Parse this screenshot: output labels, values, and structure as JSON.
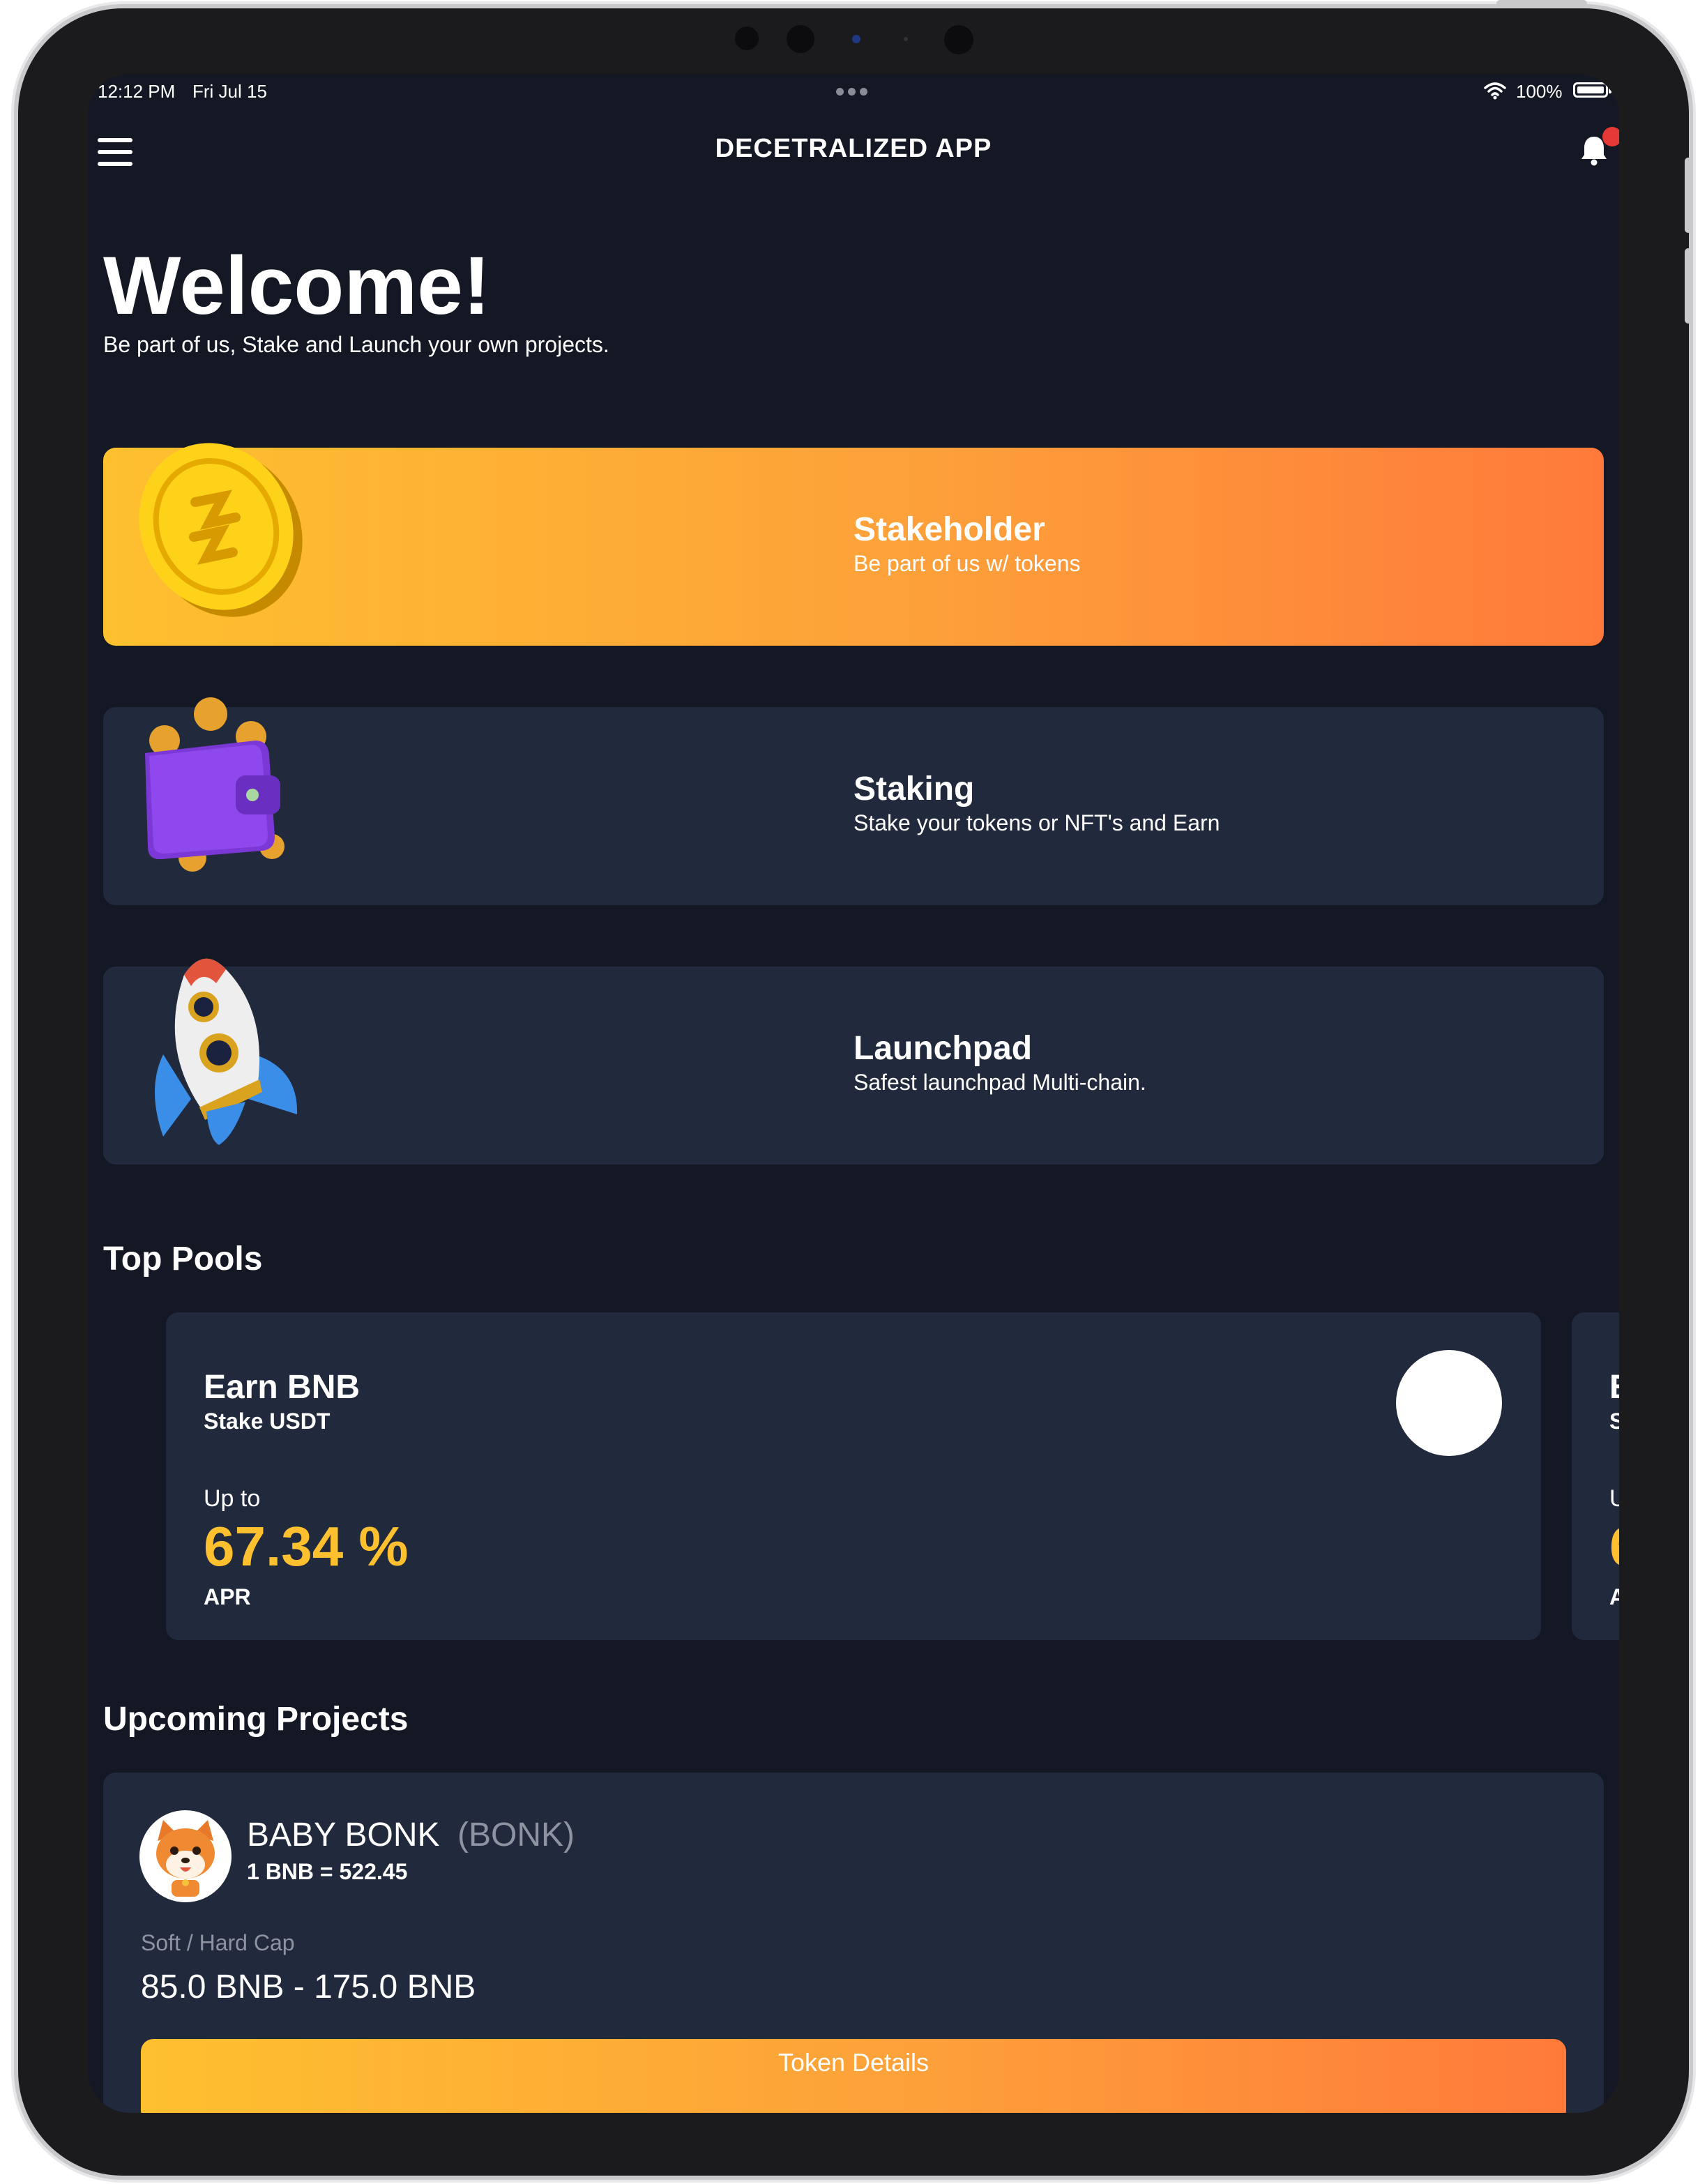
{
  "status_bar": {
    "time": "12:12 PM",
    "date": "Fri Jul 15",
    "battery": "100%",
    "battery_level": 1.0,
    "wifi_icon": "wifi-icon"
  },
  "header": {
    "title": "DECETRALIZED APP",
    "menu_icon": "menu-icon",
    "notification_icon": "bell-icon"
  },
  "welcome": {
    "heading": "Welcome!",
    "subtitle": "Be part of us, Stake and Launch your own projects."
  },
  "cards": [
    {
      "title": "Stakeholder",
      "subtitle": "Be part of us w/ tokens",
      "icon": "gold-coin-icon"
    },
    {
      "title": "Staking",
      "subtitle": "Stake your tokens or NFT's and Earn",
      "icon": "wallet-icon"
    },
    {
      "title": "Launchpad",
      "subtitle": "Safest launchpad Multi-chain.",
      "icon": "rocket-icon"
    }
  ],
  "top_pools": {
    "section_title": "Top Pools",
    "pools": [
      {
        "earn": "Earn BNB",
        "stake": "Stake USDT",
        "up_to": "Up to",
        "apr_value": "67.34 %",
        "apr_label": "APR"
      }
    ]
  },
  "upcoming": {
    "section_title": "Upcoming Projects",
    "project": {
      "name": "BABY BONK",
      "symbol": "(BONK)",
      "rate": "1 BNB = 522.45",
      "cap_label": "Soft / Hard Cap",
      "cap_value": "85.0 BNB - 175.0 BNB",
      "button_label": "Token Details",
      "logo_icon": "shiba-dog-icon"
    }
  },
  "colors": {
    "background": "#141824",
    "card": "#212a3d",
    "accent_start": "#fec02f",
    "accent_end": "#ff7a3a",
    "apr": "#fec02f",
    "badge": "#e53935"
  }
}
